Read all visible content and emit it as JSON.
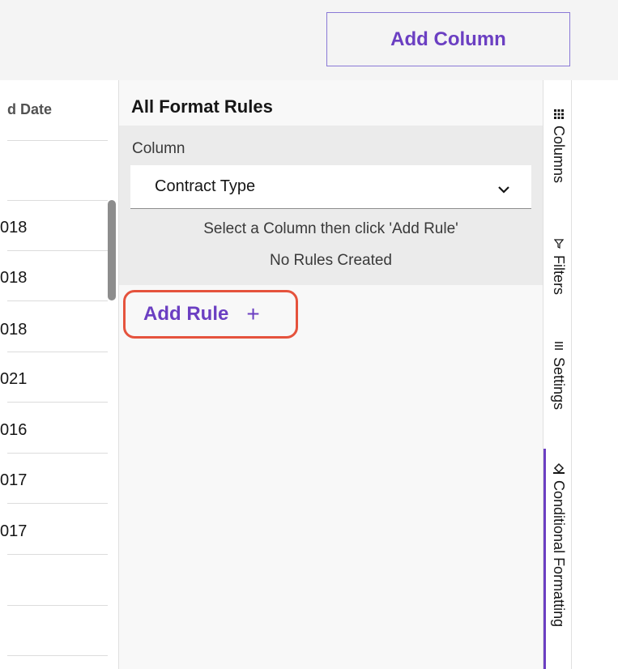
{
  "toolbar": {
    "add_column_label": "Add Column"
  },
  "grid": {
    "header": "d Date",
    "rows": [
      "018",
      "018",
      "018",
      "021",
      "016",
      "017",
      "017",
      "",
      ""
    ]
  },
  "panel": {
    "title": "All Format Rules",
    "column_label": "Column",
    "column_selected": "Contract Type",
    "hint": "Select a Column then click 'Add Rule'",
    "empty_state": "No Rules Created",
    "add_rule_label": "Add Rule",
    "add_rule_icon": "+"
  },
  "tabs": [
    {
      "label": "Columns",
      "icon": "grid-icon"
    },
    {
      "label": "Filters",
      "icon": "filter-icon"
    },
    {
      "label": "Settings",
      "icon": "settings-bars-icon"
    },
    {
      "label": "Conditional Formatting",
      "icon": "paint-bucket-icon",
      "active": true
    }
  ],
  "colors": {
    "accent": "#6b3fc2",
    "highlight": "#e5533d",
    "panel_bg": "#ebebeb"
  }
}
